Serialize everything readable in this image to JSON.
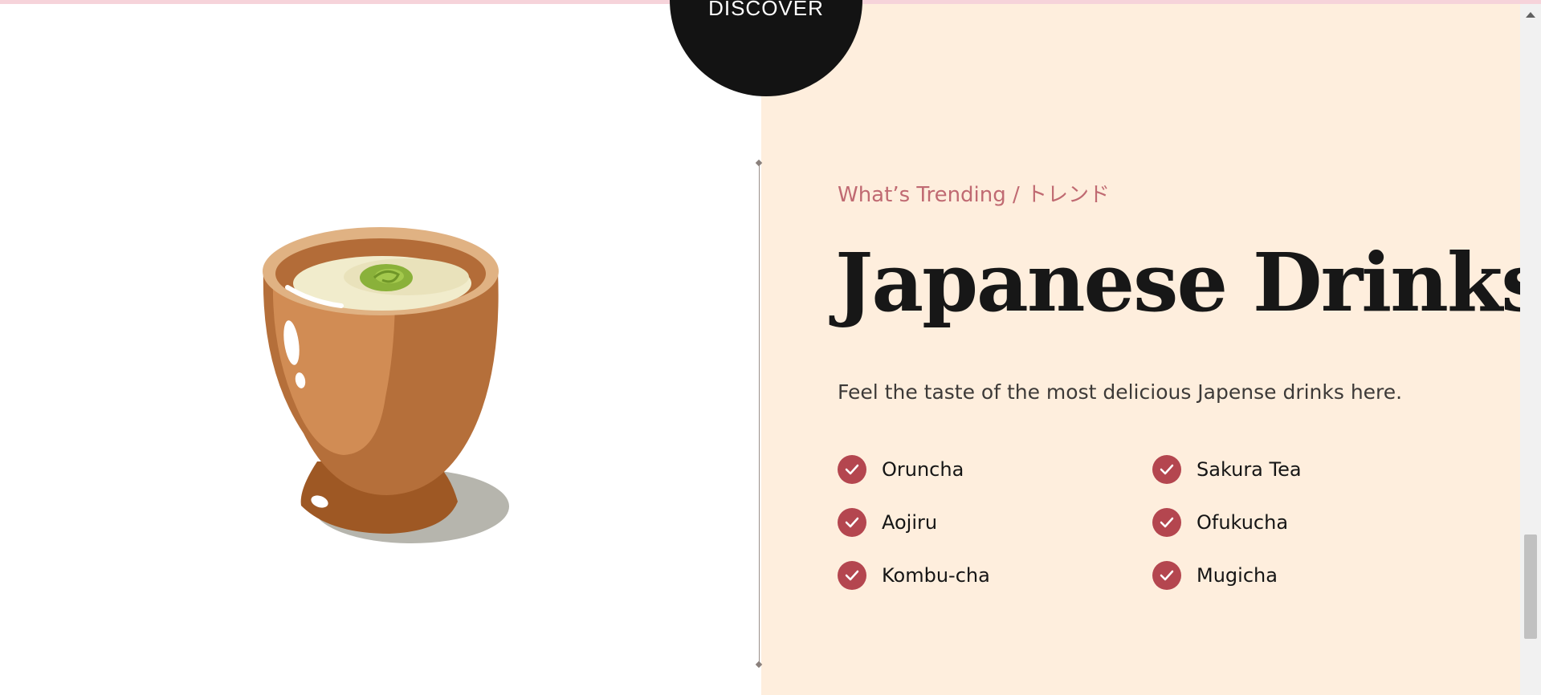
{
  "page": {
    "colors": {
      "left_background": "#ffffff",
      "right_background": "#feeedd",
      "discover_circle": "#131313",
      "accent_text": "#c06a72",
      "check_badge": "#b4464f",
      "headline": "#171717",
      "body_text": "#3d3a38",
      "top_strip": "#f6d3da"
    }
  },
  "discover_badge": {
    "label": "DISCOVER"
  },
  "image": {
    "subject": "japanese-tea-cup",
    "icon": "tea-cup-illustration"
  },
  "trending": {
    "eyebrow": "What’s Trending / トレンド",
    "title": "Japanese Drinks",
    "description": "Feel the taste of the most delicious Japense drinks here.",
    "check_icon": "check-icon",
    "drinks": [
      {
        "label": "Oruncha"
      },
      {
        "label": "Sakura Tea"
      },
      {
        "label": "Aojiru"
      },
      {
        "label": "Ofukucha"
      },
      {
        "label": "Kombu-cha"
      },
      {
        "label": "Mugicha"
      }
    ]
  }
}
